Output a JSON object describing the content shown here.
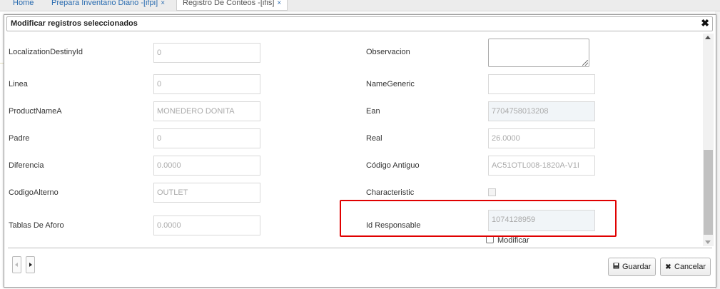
{
  "tabs": [
    {
      "label": "Home",
      "closable": false
    },
    {
      "label": "Prepara Inventario Diario -[ifpi]",
      "closable": true
    },
    {
      "label": "Registro De Conteos -[ifis]",
      "closable": true,
      "active": true
    }
  ],
  "close_glyph": "×",
  "modal": {
    "title": "Modificar registros seleccionados",
    "close_icon": "✖",
    "left_fields": [
      {
        "label": "LocalizationDestinyId",
        "value": "0"
      },
      {
        "label": "Linea",
        "value": "0"
      },
      {
        "label": "ProductNameA",
        "value": "MONEDERO DONITA"
      },
      {
        "label": "Padre",
        "value": "0"
      },
      {
        "label": "Diferencia",
        "value": "0.0000"
      },
      {
        "label": "CodigoAlterno",
        "value": "OUTLET"
      },
      {
        "label": "Tablas De Aforo",
        "value": "0.0000"
      }
    ],
    "right_fields": {
      "observacion": {
        "label": "Observacion",
        "value": ""
      },
      "name_generic": {
        "label": "NameGeneric",
        "value": ""
      },
      "ean": {
        "label": "Ean",
        "value": "7704758013208"
      },
      "real": {
        "label": "Real",
        "value": "26.0000"
      },
      "codigo_antiguo": {
        "label": "Código Antiguo",
        "value": "AC51OTL008-1820A-V1I"
      },
      "characteristic": {
        "label": "Characteristic",
        "checked": false
      },
      "id_responsable": {
        "label": "Id Responsable",
        "value": "1074128959"
      }
    },
    "modificar_label": "Modificar",
    "buttons": {
      "guardar": "Guardar",
      "cancelar": "Cancelar"
    },
    "icons": {
      "save": "save-icon",
      "cancel": "x-icon"
    },
    "highlight_color": "#e00000"
  }
}
